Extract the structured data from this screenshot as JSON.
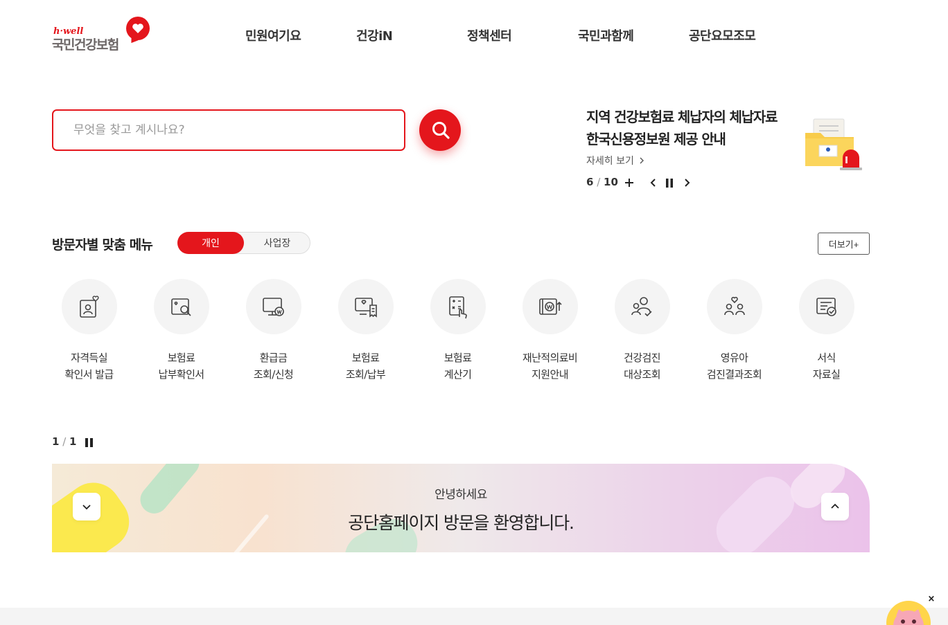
{
  "header": {
    "logo_en": "h·well",
    "logo_ko": "국민건강보험",
    "nav": [
      "민원여기요",
      "건강iN",
      "정책센터",
      "국민과함께",
      "공단요모조모"
    ]
  },
  "search": {
    "placeholder": "무엇을 찾고 계시나요?",
    "value": ""
  },
  "notice": {
    "title_line1": "지역 건강보험료 체납자의 체납자료",
    "title_line2": "한국신용정보원 제공 안내",
    "more": "자세히 보기",
    "current": "6",
    "total": "10"
  },
  "custom_menu": {
    "title": "방문자별 맞춤 메뉴",
    "tab_active": "개인",
    "tab_inactive": "사업장",
    "more": "더보기+",
    "items": [
      {
        "line1": "자격득실",
        "line2": "확인서 발급",
        "icon": "id-card-heart-icon"
      },
      {
        "line1": "보험료",
        "line2": "납부확인서",
        "icon": "document-search-icon"
      },
      {
        "line1": "환급금",
        "line2": "조회/신청",
        "icon": "monitor-won-icon"
      },
      {
        "line1": "보험료",
        "line2": "조회/납부",
        "icon": "monitor-receipt-icon"
      },
      {
        "line1": "보험료",
        "line2": "계산기",
        "icon": "calculator-touch-icon"
      },
      {
        "line1": "재난적의료비",
        "line2": "지원안내",
        "icon": "wallet-won-icon"
      },
      {
        "line1": "건강검진",
        "line2": "대상조회",
        "icon": "people-check-icon"
      },
      {
        "line1": "영유아",
        "line2": "검진결과조회",
        "icon": "family-heart-icon"
      },
      {
        "line1": "서식",
        "line2": "자료실",
        "icon": "form-check-icon"
      }
    ],
    "current": "1",
    "total": "1"
  },
  "welcome": {
    "hello": "안녕하세요",
    "message": "공단홈페이지 방문을 환영합니다."
  },
  "floating": {
    "close": "×"
  },
  "colors": {
    "brand_red": "#e4161c",
    "text_dark": "#222222",
    "circle_bg": "#f4f4f4"
  }
}
